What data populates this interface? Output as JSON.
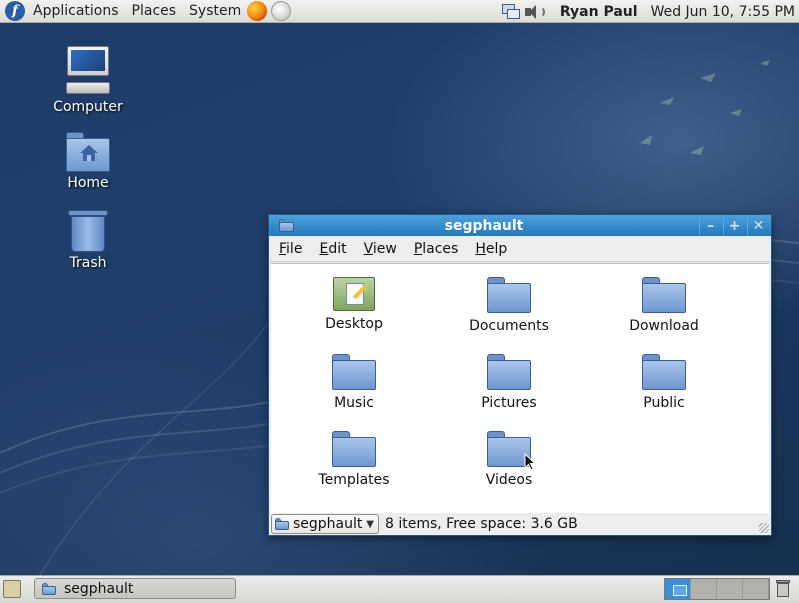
{
  "top_panel": {
    "menus": [
      "Applications",
      "Places",
      "System"
    ],
    "user": "Ryan Paul",
    "clock": "Wed Jun 10,  7:55 PM"
  },
  "desktop_icons": {
    "computer": "Computer",
    "home": "Home",
    "trash": "Trash"
  },
  "window": {
    "title": "segphault",
    "menu": [
      "File",
      "Edit",
      "View",
      "Places",
      "Help"
    ],
    "items": [
      "Desktop",
      "Documents",
      "Download",
      "Music",
      "Pictures",
      "Public",
      "Templates",
      "Videos"
    ],
    "location": "segphault",
    "status": "8 items, Free space: 3.6 GB"
  },
  "bottom_panel": {
    "task": "segphault",
    "workspaces": 4,
    "active_workspace": 1
  },
  "colors": {
    "titlebar": "#2479bd",
    "folder": "#8fb2e0",
    "desktop": "#1e3c68"
  }
}
